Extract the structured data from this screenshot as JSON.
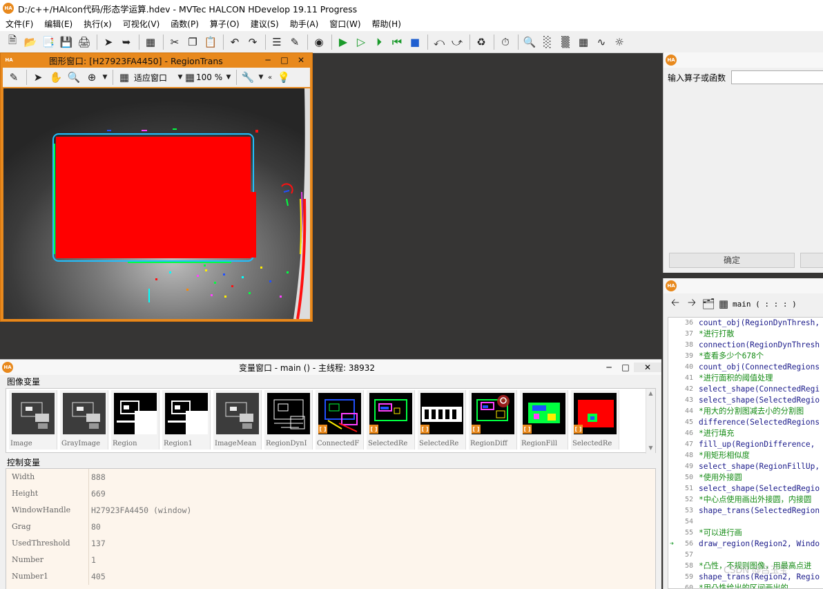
{
  "window": {
    "title": "D:/c++/HAlcon代码/形态学运算.hdev - MVTec HALCON HDevelop 19.11 Progress",
    "logo": "HA"
  },
  "menu": [
    "文件(F)",
    "编辑(E)",
    "执行(x)",
    "可视化(V)",
    "函数(P)",
    "算子(O)",
    "建议(S)",
    "助手(A)",
    "窗口(W)",
    "帮助(H)"
  ],
  "graphics_window": {
    "title": "图形窗口: [H27923FA4450] - RegionTrans",
    "fit_label": "适应窗口",
    "zoom_value": "100 %"
  },
  "operator_panel": {
    "label": "输入算子或函数",
    "ok_button": "确定"
  },
  "code_panel": {
    "procedure": "main ( : : : )",
    "lines": [
      {
        "n": "36",
        "text": "count_obj(RegionDynThresh,",
        "kind": "code"
      },
      {
        "n": "37",
        "text": "*进行打散",
        "kind": "comment"
      },
      {
        "n": "38",
        "text": "connection(RegionDynThresh",
        "kind": "code"
      },
      {
        "n": "39",
        "text": "*查看多少个678个",
        "kind": "comment"
      },
      {
        "n": "40",
        "text": "count_obj(ConnectedRegions",
        "kind": "code"
      },
      {
        "n": "41",
        "text": "*进行面积的阈值处理",
        "kind": "comment"
      },
      {
        "n": "42",
        "text": "select_shape(ConnectedRegi",
        "kind": "code"
      },
      {
        "n": "43",
        "text": "select_shape(SelectedRegio",
        "kind": "code"
      },
      {
        "n": "44",
        "text": "*用大的分割图减去小的分割图",
        "kind": "comment"
      },
      {
        "n": "45",
        "text": "difference(SelectedRegions",
        "kind": "code"
      },
      {
        "n": "46",
        "text": "*进行填充",
        "kind": "comment"
      },
      {
        "n": "47",
        "text": "fill_up(RegionDifference,",
        "kind": "code"
      },
      {
        "n": "48",
        "text": "*用矩形相似度",
        "kind": "comment"
      },
      {
        "n": "49",
        "text": "select_shape(RegionFillUp,",
        "kind": "code"
      },
      {
        "n": "50",
        "text": "*使用外接圆",
        "kind": "comment"
      },
      {
        "n": "51",
        "text": "select_shape(SelectedRegio",
        "kind": "code"
      },
      {
        "n": "52",
        "text": "*中心点使用画出外接圆，内接圆",
        "kind": "comment"
      },
      {
        "n": "53",
        "text": "shape_trans(SelectedRegion",
        "kind": "code"
      },
      {
        "n": "54",
        "text": "",
        "kind": "code"
      },
      {
        "n": "55",
        "text": "*可以进行画",
        "kind": "comment"
      },
      {
        "n": "56",
        "text": "draw_region(Region2, Windo",
        "kind": "code",
        "current": true
      },
      {
        "n": "57",
        "text": "",
        "kind": "code"
      },
      {
        "n": "58",
        "text": "*凸性，不规则图像，用最高点进",
        "kind": "comment"
      },
      {
        "n": "59",
        "text": "shape_trans(Region2, Regio",
        "kind": "code"
      },
      {
        "n": "60",
        "text": "*用凸性给出的区间画出的，",
        "kind": "comment"
      }
    ],
    "watermark": "CSDN @吕玉宝"
  },
  "variable_window": {
    "title": "变量窗口 - main () - 主线程: 38932",
    "image_section": "图像变量",
    "control_section": "控制变量",
    "iconic": [
      {
        "name": "Image",
        "kind": "gray"
      },
      {
        "name": "GrayImage",
        "kind": "gray"
      },
      {
        "name": "Region",
        "kind": "bin"
      },
      {
        "name": "Region1",
        "kind": "bin"
      },
      {
        "name": "ImageMean",
        "kind": "gray"
      },
      {
        "name": "RegionDynI",
        "kind": "edge"
      },
      {
        "name": "ConnectedF",
        "kind": "colorful"
      },
      {
        "name": "SelectedRe",
        "kind": "boxes"
      },
      {
        "name": "SelectedRe",
        "kind": "text"
      },
      {
        "name": "RegionDiff",
        "kind": "diff"
      },
      {
        "name": "RegionFill",
        "kind": "fill"
      },
      {
        "name": "SelectedRe",
        "kind": "red"
      }
    ],
    "control": [
      {
        "name": "Width",
        "value": "888"
      },
      {
        "name": "Height",
        "value": "669"
      },
      {
        "name": "WindowHandle",
        "value": "H27923FA4450 (window)"
      },
      {
        "name": "Grag",
        "value": "80"
      },
      {
        "name": "UsedThreshold",
        "value": "137"
      },
      {
        "name": "Number",
        "value": "1"
      },
      {
        "name": "Number1",
        "value": "405"
      }
    ]
  }
}
